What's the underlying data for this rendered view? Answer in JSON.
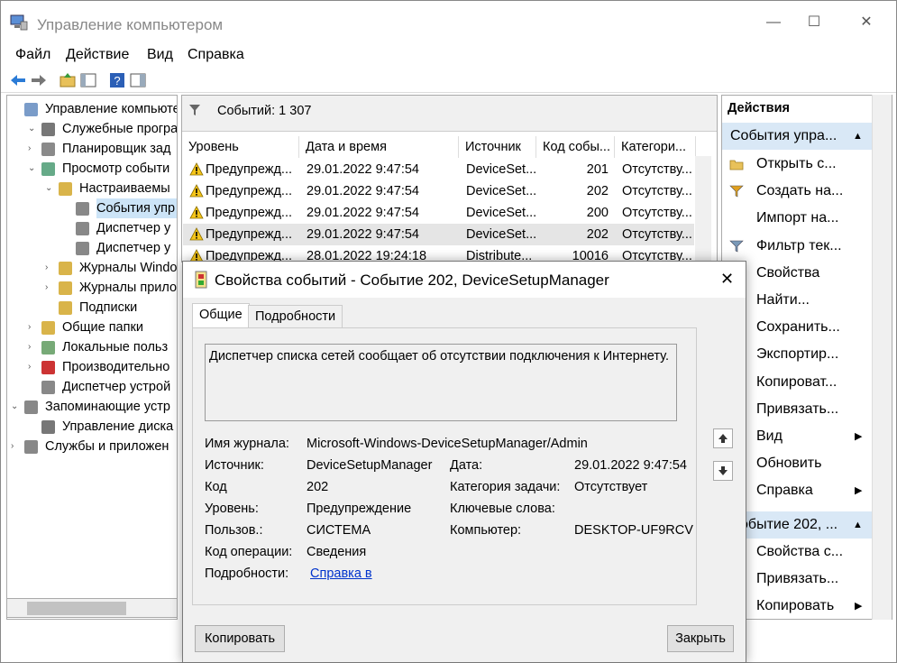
{
  "window": {
    "title": "Управление компьютером",
    "minimize": "—",
    "maximize": "☐",
    "close": "✕"
  },
  "menu": [
    "Файл",
    "Действие",
    "Вид",
    "Справка"
  ],
  "tree": [
    {
      "label": "Управление компьютер",
      "expander": ""
    },
    {
      "label": "Служебные програм",
      "expander": "⌄"
    },
    {
      "label": "Планировщик зад",
      "expander": "›"
    },
    {
      "label": "Просмотр событи",
      "expander": "⌄"
    },
    {
      "label": "Настраиваемы",
      "expander": "⌄"
    },
    {
      "label": "События упр",
      "expander": ""
    },
    {
      "label": "Диспетчер у",
      "expander": ""
    },
    {
      "label": "Диспетчер у",
      "expander": ""
    },
    {
      "label": "Журналы Windo",
      "expander": "›"
    },
    {
      "label": "Журналы прило",
      "expander": "›"
    },
    {
      "label": "Подписки",
      "expander": ""
    },
    {
      "label": "Общие папки",
      "expander": "›"
    },
    {
      "label": "Локальные польз",
      "expander": "›"
    },
    {
      "label": "Производительно",
      "expander": "›"
    },
    {
      "label": "Диспетчер устрой",
      "expander": ""
    },
    {
      "label": "Запоминающие устр",
      "expander": "⌄"
    },
    {
      "label": "Управление диска",
      "expander": ""
    },
    {
      "label": "Службы и приложен",
      "expander": "›"
    }
  ],
  "events_panel": {
    "count_label": "Событий: 1 307",
    "columns": [
      "Уровень",
      "Дата и время",
      "Источник",
      "Код собы...",
      "Категори..."
    ],
    "rows": [
      {
        "level": "Предупрежд...",
        "date": "29.01.2022 9:47:54",
        "source": "DeviceSet...",
        "code": "201",
        "category": "Отсутству..."
      },
      {
        "level": "Предупрежд...",
        "date": "29.01.2022 9:47:54",
        "source": "DeviceSet...",
        "code": "202",
        "category": "Отсутству..."
      },
      {
        "level": "Предупрежд...",
        "date": "29.01.2022 9:47:54",
        "source": "DeviceSet...",
        "code": "200",
        "category": "Отсутству..."
      },
      {
        "level": "Предупрежд...",
        "date": "29.01.2022 9:47:54",
        "source": "DeviceSet...",
        "code": "202",
        "category": "Отсутству..."
      },
      {
        "level": "Предупрежд...",
        "date": "28.01.2022 19:24:18",
        "source": "Distribute...",
        "code": "10016",
        "category": "Отсутству..."
      }
    ]
  },
  "actions": {
    "header": "Действия",
    "section1": "События упра...",
    "items1": [
      {
        "label": "Открыть с...",
        "icon": "folder-icon",
        "submenu": false
      },
      {
        "label": "Создать на...",
        "icon": "filter-create-icon",
        "submenu": false
      },
      {
        "label": "Импорт на...",
        "icon": "",
        "submenu": false
      },
      {
        "label": "Фильтр тек...",
        "icon": "filter-icon",
        "submenu": false
      },
      {
        "label": "Свойства",
        "icon": "",
        "submenu": false
      },
      {
        "label": "Найти...",
        "icon": "",
        "submenu": false
      },
      {
        "label": "Сохранить...",
        "icon": "",
        "submenu": false
      },
      {
        "label": "Экспортир...",
        "icon": "",
        "submenu": false
      },
      {
        "label": "Копироват...",
        "icon": "",
        "submenu": false
      },
      {
        "label": "Привязать...",
        "icon": "",
        "submenu": false
      },
      {
        "label": "Вид",
        "icon": "",
        "submenu": true
      },
      {
        "label": "Обновить",
        "icon": "",
        "submenu": false
      },
      {
        "label": "Справка",
        "icon": "",
        "submenu": true
      }
    ],
    "section2": "обытие 202, ...",
    "items2": [
      {
        "label": "Свойства с...",
        "submenu": false
      },
      {
        "label": "Привязать...",
        "submenu": false
      },
      {
        "label": "Копировать",
        "submenu": true
      }
    ]
  },
  "dialog": {
    "title": "Свойства событий - Событие 202, DeviceSetupManager",
    "tabs": [
      "Общие",
      "Подробности"
    ],
    "description": "Диспетчер списка сетей сообщает об отсутствии подключения к Интернету.",
    "fields": {
      "log_name_label": "Имя журнала:",
      "log_name": "Microsoft-Windows-DeviceSetupManager/Admin",
      "source_label": "Источник:",
      "source": "DeviceSetupManager",
      "date_label": "Дата:",
      "date": "29.01.2022 9:47:54",
      "code_label": "Код",
      "code": "202",
      "task_label": "Категория задачи:",
      "task": "Отсутствует",
      "level_label": "Уровень:",
      "level": "Предупреждение",
      "keywords_label": "Ключевые слова:",
      "keywords": "",
      "user_label": "Пользов.:",
      "user": "СИСТЕМА",
      "computer_label": "Компьютер:",
      "computer": "DESKTOP-UF9RCV",
      "opcode_label": "Код операции:",
      "opcode": "Сведения",
      "details_label": "Подробности:",
      "details_link": "Справка в"
    },
    "copy_button": "Копировать",
    "close_button": "Закрыть"
  }
}
